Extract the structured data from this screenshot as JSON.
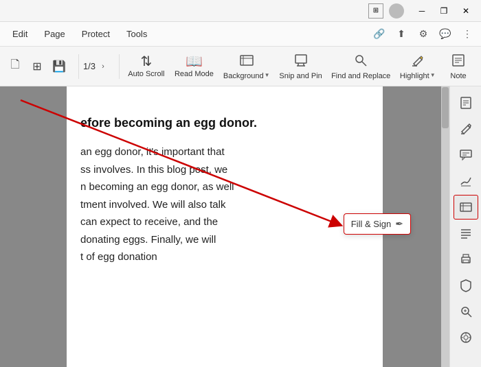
{
  "titlebar": {
    "view_icon": "⊞",
    "minimize": "─",
    "restore": "❐",
    "close": "✕"
  },
  "menubar": {
    "items": [
      "Edit",
      "Page",
      "Protect",
      "Tools"
    ],
    "icons": [
      "🔗",
      "⬆",
      "⚙",
      "💬",
      "⋮"
    ]
  },
  "toolbar": {
    "page_current": "1/3",
    "page_nav_arrow": "›",
    "tools": [
      {
        "label": "Auto Scroll",
        "icon": "⇅",
        "has_dropdown": true
      },
      {
        "label": "Read Mode",
        "icon": "📖",
        "has_dropdown": false
      },
      {
        "label": "Background",
        "icon": "✦",
        "has_dropdown": true
      },
      {
        "label": "Snip and Pin",
        "icon": "⊡",
        "has_dropdown": false
      },
      {
        "label": "Find and Replace",
        "icon": "🔍",
        "has_dropdown": false
      },
      {
        "label": "Highlight",
        "icon": "✏",
        "has_dropdown": true
      },
      {
        "label": "Note",
        "icon": "📝",
        "has_dropdown": false
      }
    ],
    "small_btns": [
      "🗋",
      "⊞",
      "💾"
    ]
  },
  "document": {
    "heading": "efore becoming an egg donor.",
    "body_lines": [
      "an egg donor, it's important that",
      "ss involves. In this blog post, we",
      "n becoming an egg donor, as well",
      "tment involved. We will also talk",
      "can expect to receive, and the",
      "   donating eggs. Finally, we will",
      "t of egg donation"
    ]
  },
  "sidebar": {
    "icons": [
      "🗋",
      "✏",
      "🗋",
      "🖊",
      "⊞",
      "⚙",
      "🖨",
      "⊡",
      "🔍",
      "◎"
    ]
  },
  "fill_sign": {
    "label": "Fill & Sign",
    "icon": "✒"
  }
}
